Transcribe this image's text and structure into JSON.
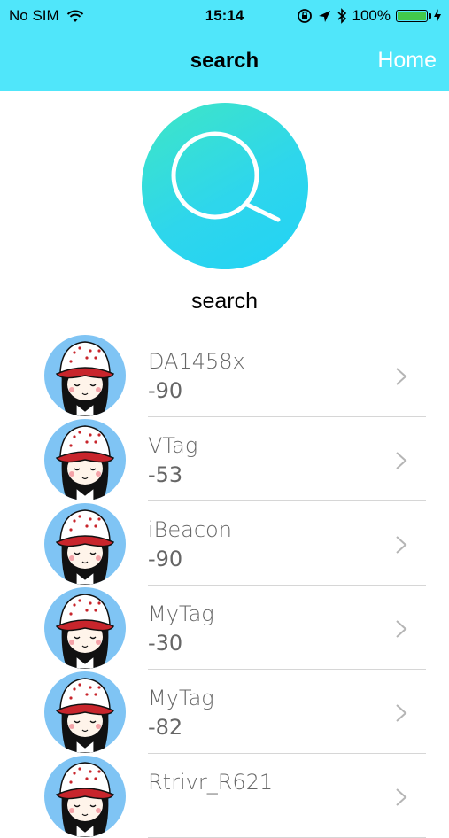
{
  "status_bar": {
    "carrier": "No SIM",
    "time": "15:14",
    "battery": "100%",
    "battery_level": 1.0,
    "icons": [
      "wifi-icon",
      "rotation-lock-icon",
      "location-icon",
      "bluetooth-icon",
      "battery-icon",
      "charging-icon"
    ]
  },
  "navbar": {
    "title": "search",
    "home_label": "Home"
  },
  "search": {
    "label": "search",
    "icon": "search-icon"
  },
  "devices": [
    {
      "name": "DA1458x",
      "rssi": "-90"
    },
    {
      "name": "VTag",
      "rssi": "-53"
    },
    {
      "name": "iBeacon",
      "rssi": "-90"
    },
    {
      "name": "MyTag",
      "rssi": "-30"
    },
    {
      "name": "MyTag",
      "rssi": "-82"
    },
    {
      "name": "Rtrivr_R621",
      "rssi": ""
    }
  ],
  "colors": {
    "nav_background": "#50e6fa",
    "battery_fill": "#42c94b",
    "search_circle_start": "#3fe6c5",
    "search_circle_end": "#22d2f5",
    "avatar_background": "#7fc4f4",
    "list_text": "#666666"
  }
}
